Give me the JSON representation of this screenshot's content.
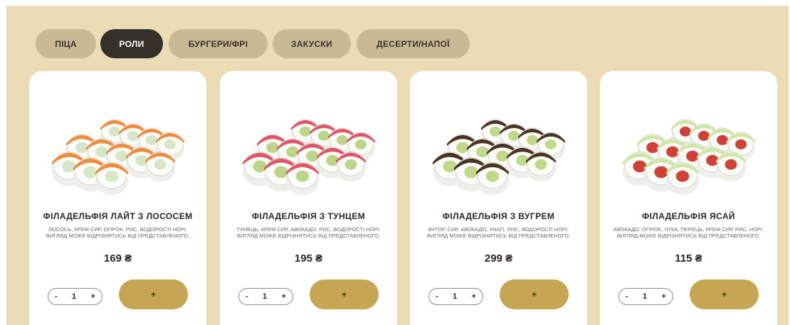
{
  "tabs": [
    {
      "label": "ПІЦА",
      "active": false
    },
    {
      "label": "РОЛИ",
      "active": true
    },
    {
      "label": "БУРГЕРИ/ФРІ",
      "active": false
    },
    {
      "label": "ЗАКУСКИ",
      "active": false
    },
    {
      "label": "ДЕСЕРТИ/НАПОЇ",
      "active": false
    }
  ],
  "products": [
    {
      "name": "ФІЛАДЕЛЬФІЯ ЛАЙТ З ЛОСОСЕМ",
      "description": "ЛОСОСЬ, КРЕМ СИР, ОГІРОК, РИС, ВОДОРОСТІ НОРІ. ВИГЛЯД МОЖЕ ВІДРІЗНЯТИСЬ ВІД ПРЕДСТАВЛЕНОГО.",
      "price": "169 ₴",
      "quantity": "1",
      "add_label": "+",
      "minus_label": "-",
      "plus_label": "+",
      "topping_color": "#f08a3c",
      "filling_color": "#d8e6c8"
    },
    {
      "name": "ФІЛАДЕЛЬФІЯ З ТУНЦЕМ",
      "description": "ТУНЕЦЬ, КРЕМ СИР, АВОКАДО, РИС, ВОДОРОСТІ НОРІ. ВИГЛЯД МОЖЕ ВІДРІЗНЯТИСЬ ВІД ПРЕДСТАВЛЕНОГО.",
      "price": "195 ₴",
      "quantity": "1",
      "add_label": "+",
      "minus_label": "-",
      "plus_label": "+",
      "topping_color": "#e0566b",
      "filling_color": "#bcd58a"
    },
    {
      "name": "ФІЛАДЕЛЬФІЯ З ВУГРЕМ",
      "description": "ВУГОР, СИР, АВОКАДО, УНАГІ, РИС, ВОДОРОСТІ НОРІ. ВИГЛЯД МОЖЕ ВІДРІЗНЯТИСЬ ВІД ПРЕДСТАВЛЕНОГО.",
      "price": "299 ₴",
      "quantity": "1",
      "add_label": "+",
      "minus_label": "-",
      "plus_label": "+",
      "topping_color": "#4a3424",
      "filling_color": "#c2d88a"
    },
    {
      "name": "ФІЛАДЕЛЬФІЯ ЯСАЙ",
      "description": "АВОКАДО, ОГІРОК, ЧУКА, ПЕРЕЦЬ, КРЕМ СИР, РИС, НОРІ. ВИГЛЯД МОЖЕ ВІДРІЗНЯТИСЬ ВІД ПРЕДСТАВЛЕНОГО.",
      "price": "115 ₴",
      "quantity": "1",
      "add_label": "+",
      "minus_label": "-",
      "plus_label": "+",
      "topping_color": "#cfe7a4",
      "filling_color": "#d0413a"
    }
  ],
  "colors": {
    "background": "#ecdcb5",
    "tab": "#c9b995",
    "tab_active": "#36302a",
    "add_button": "#c7a653"
  }
}
